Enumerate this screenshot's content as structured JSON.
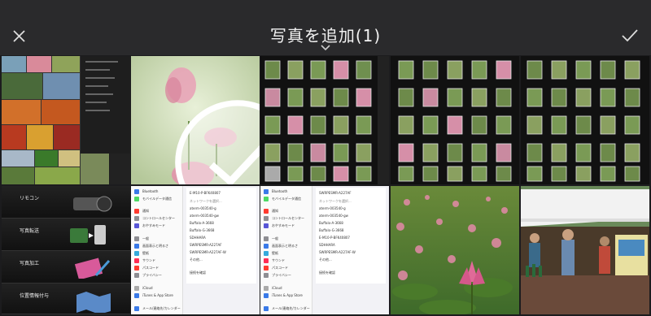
{
  "header": {
    "title": "写真を追加",
    "count": "(1)"
  },
  "icons": {
    "close": "close-icon",
    "done": "checkmark-icon",
    "dropdown": "chevron-down-icon",
    "selected": "checkmark-circle-icon"
  },
  "photos": [
    {
      "label": "photo-collage",
      "selected": false
    },
    {
      "label": "photo-lotus-flower",
      "selected": true
    },
    {
      "label": "photo-grid-thumbnails-1",
      "selected": false
    },
    {
      "label": "photo-grid-thumbnails-2",
      "selected": false
    },
    {
      "label": "photo-grid-thumbnails-3",
      "selected": false
    },
    {
      "label": "photo-remote-app",
      "selected": false
    },
    {
      "label": "photo-settings-wifi-1",
      "selected": false
    },
    {
      "label": "photo-settings-wifi-2",
      "selected": false
    },
    {
      "label": "photo-lotus-field",
      "selected": false
    },
    {
      "label": "photo-festival-tent",
      "selected": false
    }
  ],
  "remote_app": {
    "items": [
      "リモコン",
      "写真転送",
      "写真加工",
      "位置情報付与"
    ]
  },
  "settings_a": {
    "rows": [
      "Bluetooth",
      "モバイルデータ通信",
      "通知",
      "コントロールセンター",
      "おやすみモード",
      "一般",
      "画面表示と明るさ",
      "壁紙",
      "サウンド",
      "パスコード",
      "プライバシー",
      "iCloud",
      "iTunes & App Store",
      "メール/連絡先/カレンダー"
    ]
  },
  "settings_b": {
    "rows": [
      "E-M10-P-BFK40807",
      "ネットワークを選択...",
      "aterm-003540-g",
      "aterm-003540-gw",
      "Buffalo-A-3668",
      "Buffalo-G-3668",
      "SDHHARA",
      "SWRPESMR-A227AF",
      "SWRPESMR-A227AF-W",
      "その他...",
      "接続を確認"
    ]
  },
  "settings_c": {
    "rows": [
      "Bluetooth",
      "モバイルデータ通信",
      "通知",
      "コントロールセンター",
      "おやすみモード",
      "一般",
      "画面表示と明るさ",
      "壁紙",
      "サウンド",
      "パスコード",
      "プライバシー",
      "iCloud",
      "iTunes & App Store",
      "メール/連絡先/カレンダー"
    ]
  },
  "settings_d": {
    "rows": [
      "SWRPESMR-A227AF",
      "ネットワークを選択...",
      "aterm-003540-g",
      "aterm-003540-gw",
      "Buffalo-A-3668",
      "Buffalo-G-3668",
      "E-M10-P-BFK40807",
      "SDHHARA",
      "SWRPESMR-A227AF-W",
      "その他...",
      "接続を確認"
    ]
  }
}
